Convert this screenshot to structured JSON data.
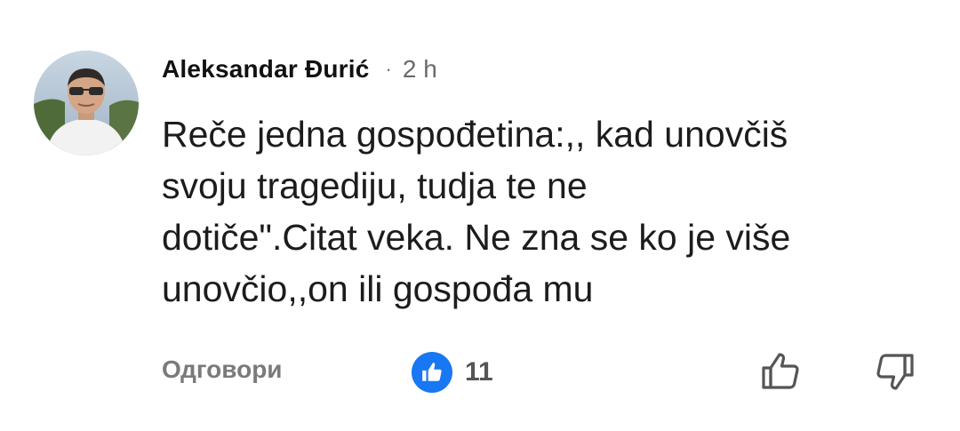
{
  "comment": {
    "author": "Aleksandar Đurić",
    "separator": "·",
    "time": "2 h",
    "text_lines": [
      "Reče jedna gospođetina:,, kad unovčiš",
      "svoju tragediju, tudja te ne",
      "dotiče\".Citat veka. Ne zna se ko je više",
      "unovčio,,on ili gospođa mu"
    ]
  },
  "actions": {
    "reply_label": "Одговори",
    "like_count": "11",
    "like_icon": "thumbs-up-icon",
    "dislike_icon": "thumbs-down-icon"
  },
  "colors": {
    "reaction_badge": "#1877f2",
    "secondary_text": "#7a7a7a"
  }
}
